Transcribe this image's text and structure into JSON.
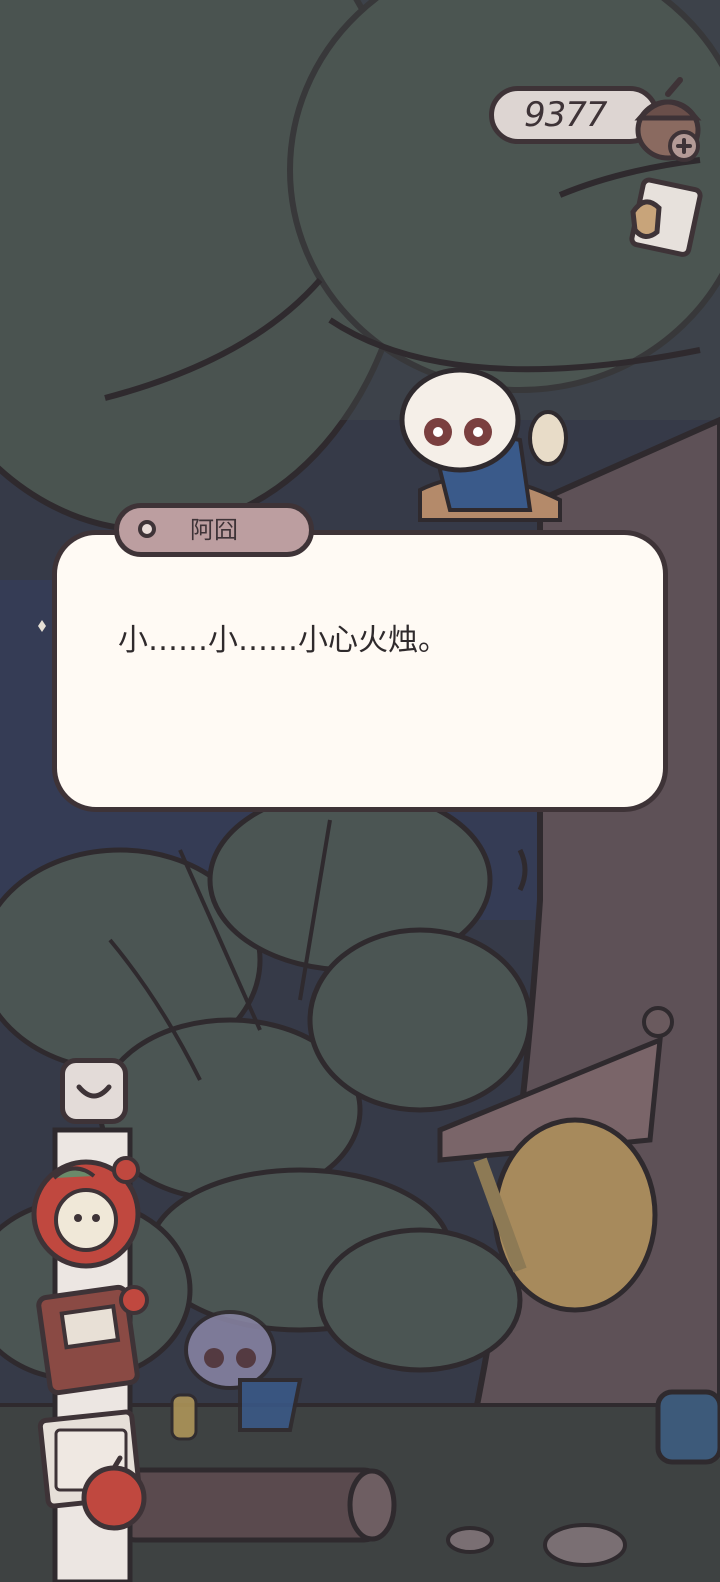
{
  "hud": {
    "currency_amount": "9377",
    "currency_icon": "acorn-icon",
    "add_currency_icon": "plus-icon",
    "mail_icon": "letter-icon"
  },
  "dialog": {
    "speaker": "阿囧",
    "text": "小……小……小心火烛。"
  },
  "side_menu": {
    "collapse_icon": "chevron-down-icon",
    "items": [
      {
        "icon": "tomato-clock-icon"
      },
      {
        "icon": "notebook-icon"
      },
      {
        "icon": "letters-apple-icon"
      }
    ]
  },
  "colors": {
    "outline": "#3e3337",
    "dialog_bg": "#fffaf4",
    "nametag_bg": "#bc9ea0",
    "tree_canopy": "#4a5450"
  }
}
